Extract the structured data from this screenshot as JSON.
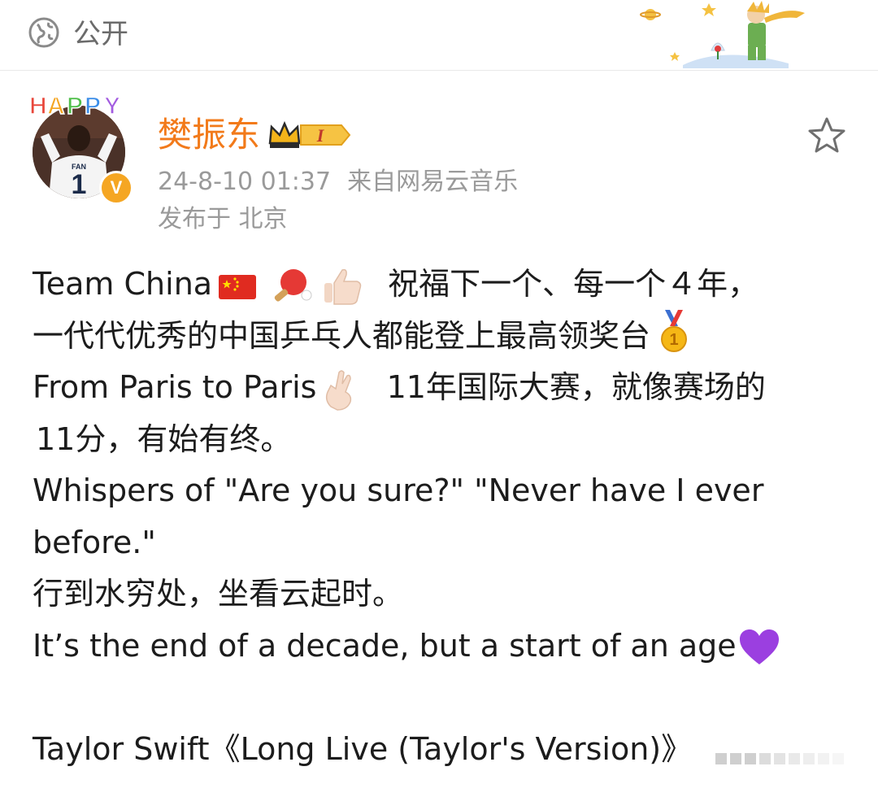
{
  "topbar": {
    "visibility_icon": "globe-icon",
    "visibility_label": "公开"
  },
  "post": {
    "author": {
      "name": "樊振东",
      "avatar_tag": "HAPPY",
      "verified_badge": "V",
      "member_level": "I"
    },
    "timestamp": "24-8-10 01:37",
    "source": "来自网易云音乐",
    "location": "发布于 北京",
    "favorite_icon": "star-outline-icon",
    "lines": [
      "Team China",
      "祝福下一个、每一个４年，",
      "一代代优秀的中国乒乓人都能登上最高领奖台",
      "From Paris to Paris",
      "11年国际大赛，就像赛场的",
      "11分，有始有终。",
      "Whispers of \"Are you sure?\" \"Never have I ever",
      "before.\"",
      "行到水穷处，坐看云起时。",
      "It’s the end of a decade, but a start of an age",
      "Taylor Swift《Long Live (Taylor's Version)》"
    ]
  },
  "colors": {
    "username": "#f27a1a",
    "meta": "#9a9a9a",
    "text": "#1c1c1c",
    "badge": "#f5a623"
  }
}
